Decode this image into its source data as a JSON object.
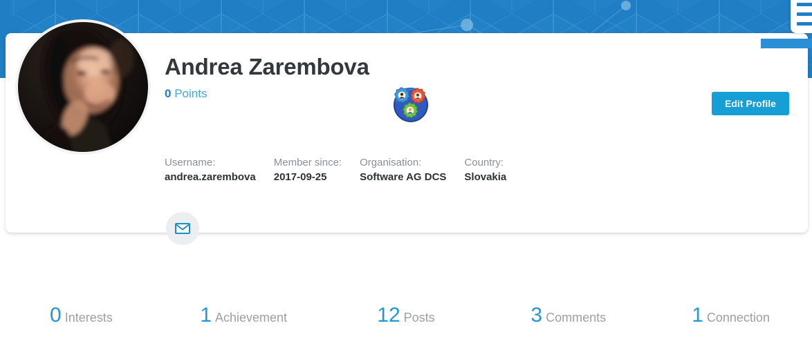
{
  "header": {
    "background_color": "#1f7ec4",
    "pattern": "hexagon-cube-network"
  },
  "corner_widget": {
    "name": "menu-list-widget",
    "lines": 3,
    "accent_color": "#1f7ec4"
  },
  "profile": {
    "display_name": "Andrea Zarembova",
    "points_value": "0",
    "points_label": "Points",
    "avatar_alt": "Andrea Zarembova profile photo",
    "badge": {
      "name": "community-gears-badge",
      "colors": [
        "#3d6fd0",
        "#4aa8e8",
        "#e8553c",
        "#6dc04a"
      ]
    },
    "edit_button_label": "Edit Profile",
    "edit_button_color": "#159fd4",
    "meta_fields": [
      {
        "label": "Username:",
        "value": "andrea.zarembova"
      },
      {
        "label": "Member since:",
        "value": "2017-09-25"
      },
      {
        "label": "Organisation:",
        "value": "Software AG DCS"
      },
      {
        "label": "Country:",
        "value": "Slovakia"
      }
    ],
    "actions": [
      {
        "name": "send-message-button",
        "icon": "envelope-icon"
      }
    ]
  },
  "stats": [
    {
      "count": "0",
      "label": "Interests"
    },
    {
      "count": "1",
      "label": "Achievement"
    },
    {
      "count": "12",
      "label": "Posts"
    },
    {
      "count": "3",
      "label": "Comments"
    },
    {
      "count": "1",
      "label": "Connection"
    }
  ],
  "colors": {
    "accent_blue": "#1f7ec4",
    "button_blue": "#159fd4",
    "stat_blue": "#2196d8",
    "text_dark": "#33383d",
    "text_muted": "#8a9097"
  }
}
